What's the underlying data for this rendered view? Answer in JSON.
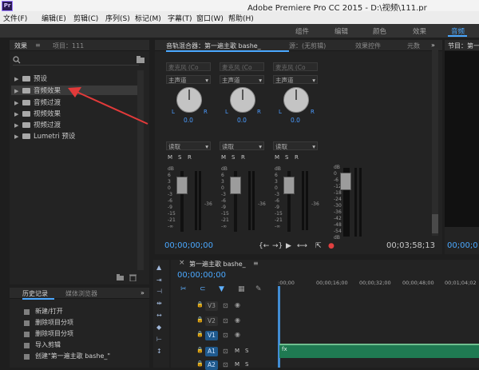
{
  "window": {
    "app_badge": "Pr",
    "title": "Adobe Premiere Pro CC 2015 - D:\\视频\\111.pr"
  },
  "menu": [
    "文件(F)",
    "编辑(E)",
    "剪辑(C)",
    "序列(S)",
    "标记(M)",
    "字幕(T)",
    "窗口(W)",
    "帮助(H)"
  ],
  "workspaces": [
    "组件",
    "编辑",
    "颜色",
    "效果",
    "音频"
  ],
  "workspace_active": "音频",
  "left_panel": {
    "tabs": [
      "效果",
      "项目：111"
    ],
    "tab_menu": "≡",
    "search_icon": "search-icon",
    "tree": [
      {
        "label": "预设"
      },
      {
        "label": "音频效果"
      },
      {
        "label": "音频过渡"
      },
      {
        "label": "视频效果"
      },
      {
        "label": "视频过渡"
      },
      {
        "label": "Lumetri 预设"
      }
    ]
  },
  "mixer": {
    "tabs": [
      "音轨混合器：第一遍主歌 bashe_",
      "源：(无剪辑)",
      "效果控件",
      "元数"
    ],
    "more": "»",
    "channels": [
      {
        "input": "麦克风 (Co",
        "bus": "主声道",
        "value": "0.0",
        "automation": "读取"
      },
      {
        "input": "麦克风 (Co",
        "bus": "主声道",
        "value": "0.0",
        "automation": "读取"
      },
      {
        "input": "麦克风 (Co",
        "bus": "主声道",
        "value": "0.0",
        "automation": "读取"
      }
    ],
    "l_label": "L",
    "r_label": "R",
    "msr": [
      "M",
      "S",
      "R"
    ],
    "scale": [
      "dB",
      "6",
      "3",
      "0",
      "-3",
      "-6",
      "-9",
      "-15",
      "-21",
      "-∞"
    ],
    "meter_scale": [
      "dB",
      "0",
      "-6",
      "-12",
      "-18",
      "-24",
      "-30",
      "-36",
      "-42",
      "-48",
      "-54",
      "dB"
    ],
    "timecode_left": "00;00;00;00",
    "timecode_right": "00;03;58;13"
  },
  "program": {
    "tab": "节目：第一",
    "timecode": "00;00;0"
  },
  "timeline": {
    "close": "×",
    "sequence_tab": "第一遍主歌 bashe_",
    "menu": "≡",
    "timecode": "00;00;00;00",
    "ruler": [
      ":00;00",
      "00;00;16;00",
      "00;00;32;00",
      "00;00;48;00",
      "00;01;04;02"
    ],
    "video_tracks": [
      "V3",
      "V2",
      "V1"
    ],
    "audio_tracks": [
      "A1",
      "A2"
    ],
    "clip_label": "fx"
  },
  "history_panel": {
    "tabs": [
      "历史记录",
      "媒体浏览器"
    ],
    "more": "»",
    "items": [
      "新建/打开",
      "删除项目分项",
      "删除项目分项",
      "导入剪辑",
      "创建\"第一遍主歌 bashe_\""
    ]
  }
}
